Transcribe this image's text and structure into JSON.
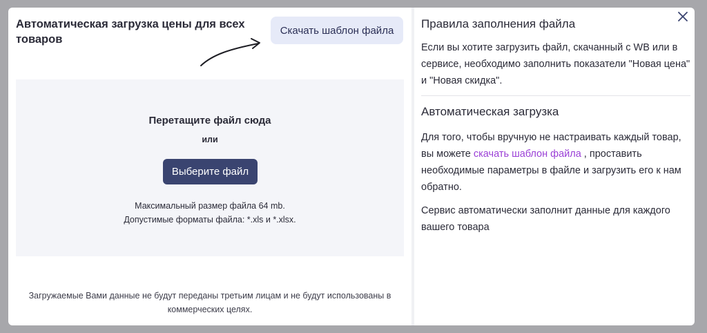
{
  "modal": {
    "title": "Автоматическая загрузка цены для всех товаров",
    "template_button": "Скачать шаблон файла",
    "dropzone": {
      "title": "Перетащите файл сюда",
      "or": "или",
      "choose_button": "Выберите файл",
      "max_size": "Максимальный размер файла 64 mb.",
      "formats": "Допустимые форматы файла: *.xls и *.xlsx."
    },
    "disclaimer": "Загружаемые Вами данные не будут переданы третьим лицам и не будут использованы в коммерческих целях."
  },
  "rules": {
    "title": "Правила заполнения файла",
    "text": "Если вы хотите загрузить файл, скачанный с WB или в сервисе, необходимо заполнить показатели \"Новая цена\" и \"Новая скидка\"."
  },
  "auto": {
    "title": "Автоматическая загрузка",
    "text_before": "Для того, чтобы вручную не настраивать каждый товар, вы можете ",
    "link": "скачать шаблон файла",
    "text_after": " , проставить необходимые параметры в файле и загрузить его к нам обратно.",
    "text2": "Сервис автоматически заполнит данные для каждого вашего товара"
  },
  "icons": {
    "close": "close-icon",
    "arrow": "curved-arrow-icon"
  },
  "colors": {
    "primary_button": "#3a4470",
    "secondary_button": "#e6eaf8",
    "link": "#9a3fd6",
    "dropzone_bg": "#f4f5f9"
  }
}
